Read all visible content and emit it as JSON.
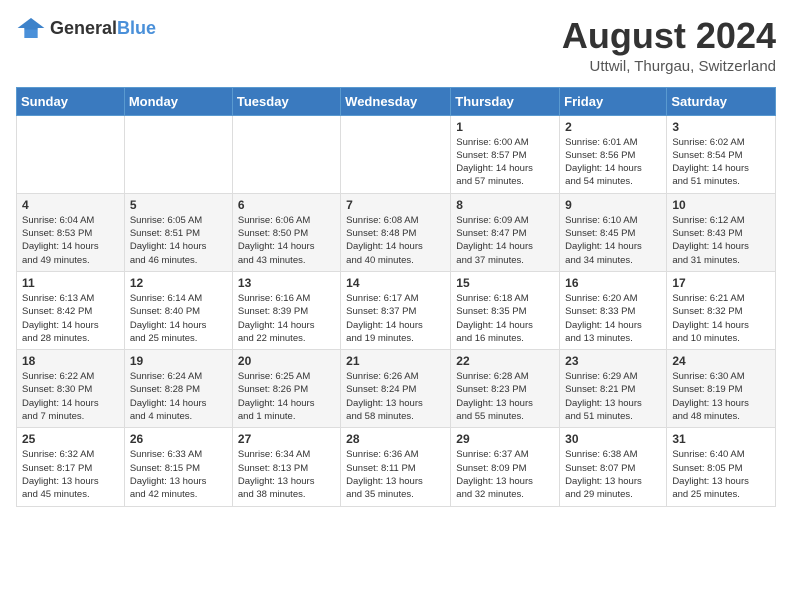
{
  "logo": {
    "text_general": "General",
    "text_blue": "Blue"
  },
  "title": {
    "month_year": "August 2024",
    "location": "Uttwil, Thurgau, Switzerland"
  },
  "days_of_week": [
    "Sunday",
    "Monday",
    "Tuesday",
    "Wednesday",
    "Thursday",
    "Friday",
    "Saturday"
  ],
  "weeks": [
    {
      "days": [
        {
          "num": "",
          "info": ""
        },
        {
          "num": "",
          "info": ""
        },
        {
          "num": "",
          "info": ""
        },
        {
          "num": "",
          "info": ""
        },
        {
          "num": "1",
          "info": "Sunrise: 6:00 AM\nSunset: 8:57 PM\nDaylight: 14 hours\nand 57 minutes."
        },
        {
          "num": "2",
          "info": "Sunrise: 6:01 AM\nSunset: 8:56 PM\nDaylight: 14 hours\nand 54 minutes."
        },
        {
          "num": "3",
          "info": "Sunrise: 6:02 AM\nSunset: 8:54 PM\nDaylight: 14 hours\nand 51 minutes."
        }
      ]
    },
    {
      "days": [
        {
          "num": "4",
          "info": "Sunrise: 6:04 AM\nSunset: 8:53 PM\nDaylight: 14 hours\nand 49 minutes."
        },
        {
          "num": "5",
          "info": "Sunrise: 6:05 AM\nSunset: 8:51 PM\nDaylight: 14 hours\nand 46 minutes."
        },
        {
          "num": "6",
          "info": "Sunrise: 6:06 AM\nSunset: 8:50 PM\nDaylight: 14 hours\nand 43 minutes."
        },
        {
          "num": "7",
          "info": "Sunrise: 6:08 AM\nSunset: 8:48 PM\nDaylight: 14 hours\nand 40 minutes."
        },
        {
          "num": "8",
          "info": "Sunrise: 6:09 AM\nSunset: 8:47 PM\nDaylight: 14 hours\nand 37 minutes."
        },
        {
          "num": "9",
          "info": "Sunrise: 6:10 AM\nSunset: 8:45 PM\nDaylight: 14 hours\nand 34 minutes."
        },
        {
          "num": "10",
          "info": "Sunrise: 6:12 AM\nSunset: 8:43 PM\nDaylight: 14 hours\nand 31 minutes."
        }
      ]
    },
    {
      "days": [
        {
          "num": "11",
          "info": "Sunrise: 6:13 AM\nSunset: 8:42 PM\nDaylight: 14 hours\nand 28 minutes."
        },
        {
          "num": "12",
          "info": "Sunrise: 6:14 AM\nSunset: 8:40 PM\nDaylight: 14 hours\nand 25 minutes."
        },
        {
          "num": "13",
          "info": "Sunrise: 6:16 AM\nSunset: 8:39 PM\nDaylight: 14 hours\nand 22 minutes."
        },
        {
          "num": "14",
          "info": "Sunrise: 6:17 AM\nSunset: 8:37 PM\nDaylight: 14 hours\nand 19 minutes."
        },
        {
          "num": "15",
          "info": "Sunrise: 6:18 AM\nSunset: 8:35 PM\nDaylight: 14 hours\nand 16 minutes."
        },
        {
          "num": "16",
          "info": "Sunrise: 6:20 AM\nSunset: 8:33 PM\nDaylight: 14 hours\nand 13 minutes."
        },
        {
          "num": "17",
          "info": "Sunrise: 6:21 AM\nSunset: 8:32 PM\nDaylight: 14 hours\nand 10 minutes."
        }
      ]
    },
    {
      "days": [
        {
          "num": "18",
          "info": "Sunrise: 6:22 AM\nSunset: 8:30 PM\nDaylight: 14 hours\nand 7 minutes."
        },
        {
          "num": "19",
          "info": "Sunrise: 6:24 AM\nSunset: 8:28 PM\nDaylight: 14 hours\nand 4 minutes."
        },
        {
          "num": "20",
          "info": "Sunrise: 6:25 AM\nSunset: 8:26 PM\nDaylight: 14 hours\nand 1 minute."
        },
        {
          "num": "21",
          "info": "Sunrise: 6:26 AM\nSunset: 8:24 PM\nDaylight: 13 hours\nand 58 minutes."
        },
        {
          "num": "22",
          "info": "Sunrise: 6:28 AM\nSunset: 8:23 PM\nDaylight: 13 hours\nand 55 minutes."
        },
        {
          "num": "23",
          "info": "Sunrise: 6:29 AM\nSunset: 8:21 PM\nDaylight: 13 hours\nand 51 minutes."
        },
        {
          "num": "24",
          "info": "Sunrise: 6:30 AM\nSunset: 8:19 PM\nDaylight: 13 hours\nand 48 minutes."
        }
      ]
    },
    {
      "days": [
        {
          "num": "25",
          "info": "Sunrise: 6:32 AM\nSunset: 8:17 PM\nDaylight: 13 hours\nand 45 minutes."
        },
        {
          "num": "26",
          "info": "Sunrise: 6:33 AM\nSunset: 8:15 PM\nDaylight: 13 hours\nand 42 minutes."
        },
        {
          "num": "27",
          "info": "Sunrise: 6:34 AM\nSunset: 8:13 PM\nDaylight: 13 hours\nand 38 minutes."
        },
        {
          "num": "28",
          "info": "Sunrise: 6:36 AM\nSunset: 8:11 PM\nDaylight: 13 hours\nand 35 minutes."
        },
        {
          "num": "29",
          "info": "Sunrise: 6:37 AM\nSunset: 8:09 PM\nDaylight: 13 hours\nand 32 minutes."
        },
        {
          "num": "30",
          "info": "Sunrise: 6:38 AM\nSunset: 8:07 PM\nDaylight: 13 hours\nand 29 minutes."
        },
        {
          "num": "31",
          "info": "Sunrise: 6:40 AM\nSunset: 8:05 PM\nDaylight: 13 hours\nand 25 minutes."
        }
      ]
    }
  ]
}
